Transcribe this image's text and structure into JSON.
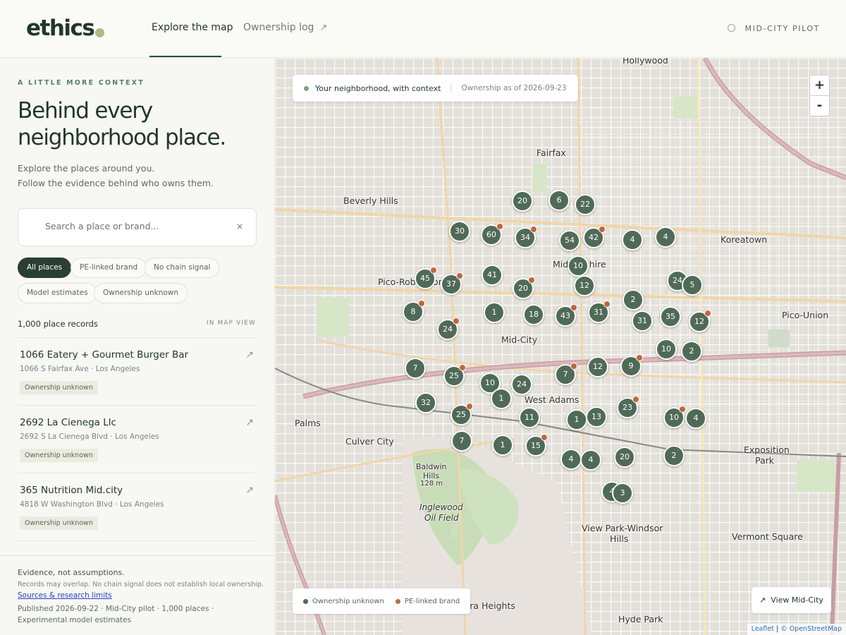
{
  "header": {
    "logo": "ethics",
    "tabs": [
      {
        "label": "Explore the map"
      },
      {
        "label": "Ownership log"
      }
    ],
    "pilot": "MID-CITY PILOT"
  },
  "sidebar": {
    "eyebrow": "A LITTLE MORE CONTEXT",
    "headline": "Behind every neighborhood place.",
    "intro_line1": "Explore the places around you.",
    "intro_line2": "Follow the evidence behind who owns them.",
    "search_placeholder": "Search a place or brand...",
    "search_clear": "×",
    "filters": [
      "All places",
      "PE-linked brand",
      "No chain signal",
      "Model estimates",
      "Ownership unknown"
    ],
    "records_count": "1,000 place records",
    "map_view_label": "IN MAP VIEW",
    "places": [
      {
        "name": "1066 Eatery + Gourmet Burger Bar",
        "address": "1066 S Fairfax Ave · Los Angeles",
        "badge": "Ownership unknown"
      },
      {
        "name": "2692 La Cienega Llc",
        "address": "2692 S La Cienega Blvd · Los Angeles",
        "badge": "Ownership unknown"
      },
      {
        "name": "365 Nutrition Mid.city",
        "address": "4818 W Washington Blvd · Los Angeles",
        "badge": "Ownership unknown"
      }
    ],
    "footer": {
      "title": "Evidence, not assumptions.",
      "note": "Records may overlap. No chain signal does not establish local ownership.",
      "link": "Sources & research limits",
      "published": "Published 2026-09-22 · Mid-City pilot · 1,000 places · Experimental model estimates"
    }
  },
  "map": {
    "pill_title": "Your neighborhood, with context",
    "pill_date": "Ownership as of 2026-09-23",
    "zoom_in": "+",
    "zoom_out": "-",
    "legend_unknown": "Ownership unknown",
    "legend_pe": "PE-linked brand",
    "view_button": "View Mid-City",
    "attrib_leaflet": "Leaflet",
    "attrib_osm": "© OpenStreetMap",
    "colors": {
      "cluster": "#4f6b58",
      "pe": "#c0673c",
      "unknown": "#4f6b58"
    },
    "labels": [
      {
        "text": "Hollywood"
      },
      {
        "text": "Fairfax"
      },
      {
        "text": "Beverly Hills"
      },
      {
        "text": "Koreatown"
      },
      {
        "text": "Pico-Robertson"
      },
      {
        "text": "Mid-Wilshire"
      },
      {
        "text": "Pico-Union"
      },
      {
        "text": "Mid-City"
      },
      {
        "text": "West Adams"
      },
      {
        "text": "Palms"
      },
      {
        "text": "Culver City"
      },
      {
        "text": "Exposition"
      },
      {
        "text": "Park"
      },
      {
        "text": "Baldwin"
      },
      {
        "text": "Hills"
      },
      {
        "text": "128 m"
      },
      {
        "text": "Inglewood"
      },
      {
        "text": "Oil Field"
      },
      {
        "text": "View Park-Windsor"
      },
      {
        "text": "Hills"
      },
      {
        "text": "Vermont Square"
      },
      {
        "text": "Ladera Heights"
      },
      {
        "text": "Hyde Park"
      }
    ],
    "clusters": [
      {
        "count": 20,
        "pe": false
      },
      {
        "count": 6,
        "pe": false
      },
      {
        "count": 22,
        "pe": false
      },
      {
        "count": 30,
        "pe": false
      },
      {
        "count": 60,
        "pe": true
      },
      {
        "count": 34,
        "pe": true
      },
      {
        "count": 54,
        "pe": false
      },
      {
        "count": 42,
        "pe": true
      },
      {
        "count": 4,
        "pe": false
      },
      {
        "count": 4,
        "pe": false
      },
      {
        "count": 10,
        "pe": false
      },
      {
        "count": 45,
        "pe": true
      },
      {
        "count": 37,
        "pe": true
      },
      {
        "count": 41,
        "pe": false
      },
      {
        "count": 20,
        "pe": true
      },
      {
        "count": 12,
        "pe": false
      },
      {
        "count": 24,
        "pe": false
      },
      {
        "count": 5,
        "pe": false
      },
      {
        "count": 8,
        "pe": true
      },
      {
        "count": 1,
        "pe": false
      },
      {
        "count": 18,
        "pe": false
      },
      {
        "count": 43,
        "pe": true
      },
      {
        "count": 31,
        "pe": true
      },
      {
        "count": 2,
        "pe": false
      },
      {
        "count": 35,
        "pe": false
      },
      {
        "count": 12,
        "pe": true
      },
      {
        "count": 24,
        "pe": true
      },
      {
        "count": 31,
        "pe": false
      },
      {
        "count": 10,
        "pe": false
      },
      {
        "count": 2,
        "pe": false
      },
      {
        "count": 7,
        "pe": false
      },
      {
        "count": 25,
        "pe": true
      },
      {
        "count": 10,
        "pe": false
      },
      {
        "count": 24,
        "pe": false
      },
      {
        "count": 7,
        "pe": true
      },
      {
        "count": 12,
        "pe": false
      },
      {
        "count": 9,
        "pe": true
      },
      {
        "count": 1,
        "pe": false
      },
      {
        "count": 32,
        "pe": false
      },
      {
        "count": 25,
        "pe": true
      },
      {
        "count": 11,
        "pe": false
      },
      {
        "count": 1,
        "pe": false
      },
      {
        "count": 13,
        "pe": false
      },
      {
        "count": 23,
        "pe": true
      },
      {
        "count": 10,
        "pe": true
      },
      {
        "count": 4,
        "pe": false
      },
      {
        "count": 7,
        "pe": false
      },
      {
        "count": 1,
        "pe": false
      },
      {
        "count": 15,
        "pe": true
      },
      {
        "count": 4,
        "pe": false
      },
      {
        "count": 4,
        "pe": false
      },
      {
        "count": 20,
        "pe": false
      },
      {
        "count": 2,
        "pe": false
      },
      {
        "count": 4,
        "pe": false
      },
      {
        "count": 3,
        "pe": false
      }
    ]
  }
}
